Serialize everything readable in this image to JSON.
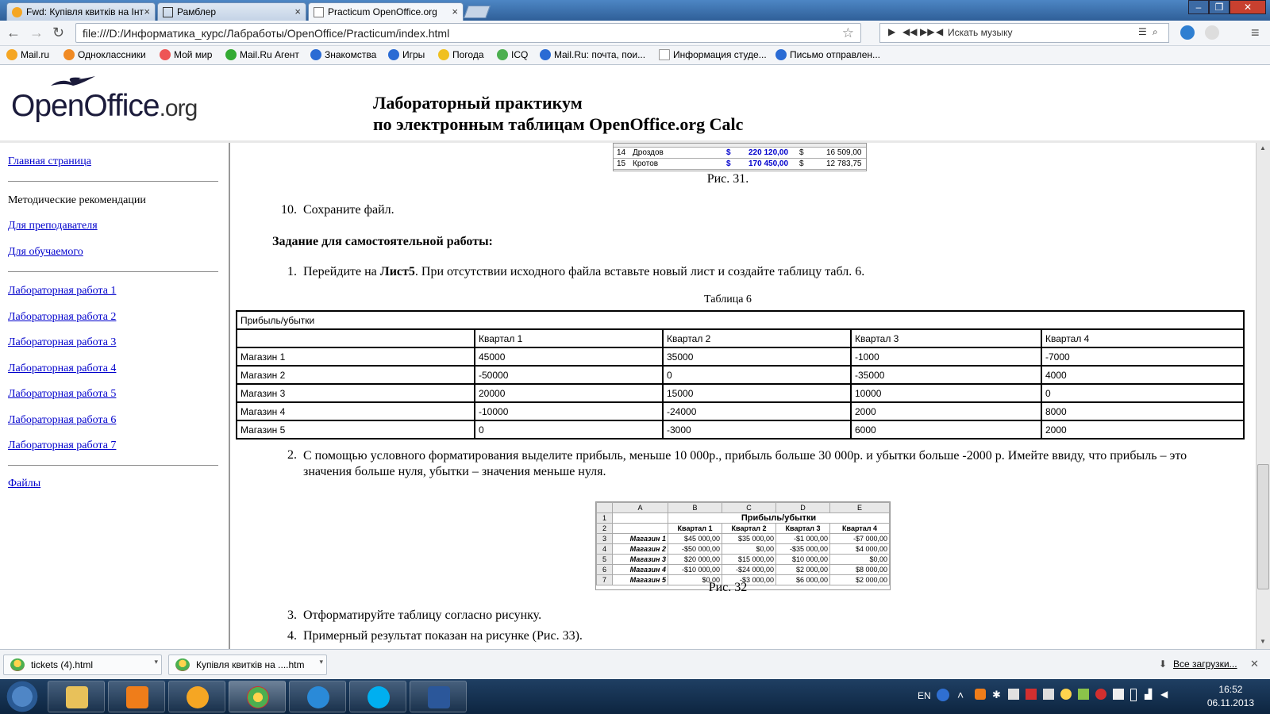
{
  "browser": {
    "tabs": [
      {
        "label": "Fwd: Купівля квитків на Інт"
      },
      {
        "label": "Рамблер"
      },
      {
        "label": "Practicum OpenOffice.org"
      }
    ],
    "url": "file:///D:/Информатика_курс/Лабработы/OpenOffice/Practicum/index.html",
    "music_placeholder": "Искать музыку",
    "bookmarks": [
      {
        "label": "Mail.ru",
        "color": "#f5a623"
      },
      {
        "label": "Одноклассники",
        "color": "#f08a24"
      },
      {
        "label": "Мой мир",
        "color": "#e55"
      },
      {
        "label": "Mail.Ru Агент",
        "color": "#3a3"
      },
      {
        "label": "Знакомства",
        "color": "#2a6bd4"
      },
      {
        "label": "Игры",
        "color": "#2a6bd4"
      },
      {
        "label": "Погода",
        "color": "#f0c020"
      },
      {
        "label": "ICQ",
        "color": "#4caf50"
      },
      {
        "label": "Mail.Ru: почта, пои...",
        "color": "#2a6bd4"
      },
      {
        "label": "Информация студе...",
        "color": "#ccc"
      },
      {
        "label": "Письмо отправлен...",
        "color": "#2a6bd4"
      }
    ]
  },
  "header": {
    "logo_text": "OpenOffice",
    "logo_suffix": ".org",
    "title_line1": "Лабораторный практикум",
    "title_line2": "по электронным таблицам OpenOffice.org Calc"
  },
  "nav": {
    "home": "Главная страница",
    "methods": "Методические рекомендации",
    "teacher": "Для преподавателя",
    "student": "Для обучаемого",
    "labs": [
      "Лабораторная работа 1",
      "Лабораторная работа 2",
      "Лабораторная работа 3",
      "Лабораторная работа 4",
      "Лабораторная работа 5",
      "Лабораторная работа 6",
      "Лабораторная работа 7"
    ],
    "files": "Файлы"
  },
  "content": {
    "top_fragment": [
      {
        "n": "14",
        "name": "Дроздов",
        "cur": "$",
        "v1": "220 120,00",
        "cur2": "$",
        "v2": "16 509,00"
      },
      {
        "n": "15",
        "name": "Кротов",
        "cur": "$",
        "v1": "170 450,00",
        "cur2": "$",
        "v2": "12 783,75"
      }
    ],
    "fig31_caption": "Рис. 31.",
    "step10_num": "10.",
    "step10": "Сохраните файл.",
    "task_heading": "Задание для самостоятельной работы:",
    "step1_num": "1.",
    "step1_pre": "Перейдите на ",
    "step1_bold": "Лист5",
    "step1_post": ". При отсутствии исходного файла вставьте новый лист и создайте таблицу табл. 6.",
    "table6_caption": "Таблица 6",
    "table6": {
      "title": "Прибыль/убытки",
      "headers": [
        "",
        "Квартал 1",
        "Квартал 2",
        "Квартал 3",
        "Квартал 4"
      ],
      "rows": [
        [
          "Магазин 1",
          "45000",
          "35000",
          "-1000",
          "-7000"
        ],
        [
          "Магазин 2",
          "-50000",
          "0",
          "-35000",
          "4000"
        ],
        [
          "Магазин 3",
          "20000",
          "15000",
          "10000",
          "0"
        ],
        [
          "Магазин 4",
          "-10000",
          "-24000",
          "2000",
          "8000"
        ],
        [
          "Магазин 5",
          "0",
          "-3000",
          "6000",
          "2000"
        ]
      ]
    },
    "step2_num": "2.",
    "step2": "С помощью условного форматирования выделите прибыль, меньше 10 000р., прибыль больше 30 000р. и убытки больше -2000 р. Имейте ввиду, что прибыль – это значения больше нуля, убытки – значения меньше нуля.",
    "fig32": {
      "cols": [
        "A",
        "B",
        "C",
        "D",
        "E"
      ],
      "title": "Прибыль/убытки",
      "headers": [
        "Квартал 1",
        "Квартал 2",
        "Квартал 3",
        "Квартал 4"
      ],
      "rows": [
        [
          "Магазин 1",
          "$45 000,00",
          "$35 000,00",
          "-$1 000,00",
          "-$7 000,00"
        ],
        [
          "Магазин 2",
          "-$50 000,00",
          "$0,00",
          "-$35 000,00",
          "$4 000,00"
        ],
        [
          "Магазин 3",
          "$20 000,00",
          "$15 000,00",
          "$10 000,00",
          "$0,00"
        ],
        [
          "Магазин 4",
          "-$10 000,00",
          "-$24 000,00",
          "$2 000,00",
          "$8 000,00"
        ],
        [
          "Магазин 5",
          "$0,00",
          "-$3 000,00",
          "$6 000,00",
          "$2 000,00"
        ]
      ]
    },
    "fig32_caption": "Рис. 32",
    "step3_num": "3.",
    "step3": "Отформатируйте таблицу согласно рисунку.",
    "step4_num": "4.",
    "step4": "Примерный результат показан на рисунке (Рис. 33)."
  },
  "downloads": {
    "items": [
      "tickets (4).html",
      "Купівля квитків на ....htm"
    ],
    "all": "Все загрузки..."
  },
  "taskbar": {
    "lang": "EN",
    "time": "16:52",
    "date": "06.11.2013"
  }
}
